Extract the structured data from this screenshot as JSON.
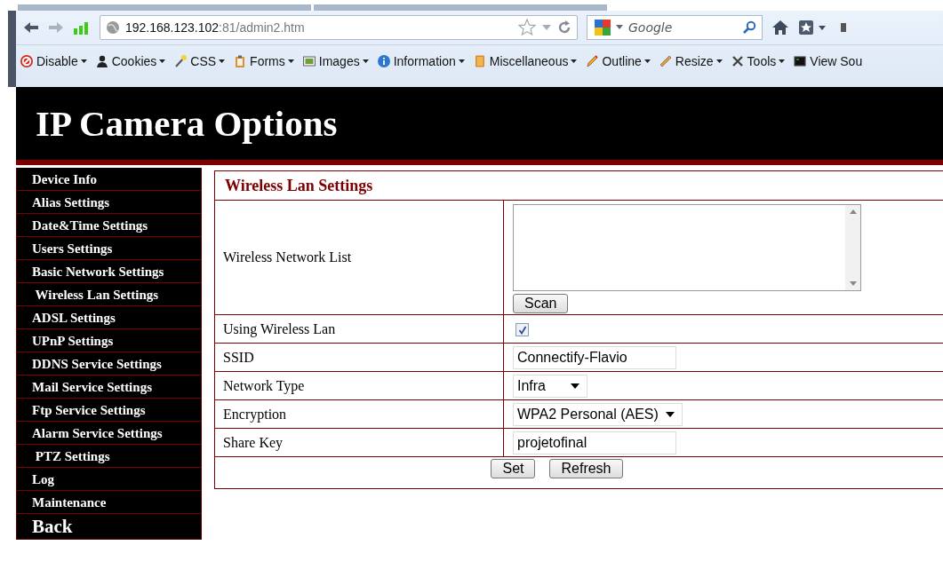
{
  "browser": {
    "address_host": "192.168.123.102",
    "address_rest": ":81/admin2.htm",
    "search_placeholder": "Google",
    "bookmarks": [
      {
        "label": "Disable"
      },
      {
        "label": "Cookies"
      },
      {
        "label": "CSS"
      },
      {
        "label": "Forms"
      },
      {
        "label": "Images"
      },
      {
        "label": "Information"
      },
      {
        "label": "Miscellaneous"
      },
      {
        "label": "Outline"
      },
      {
        "label": "Resize"
      },
      {
        "label": "Tools"
      },
      {
        "label": "View Sou"
      }
    ]
  },
  "page": {
    "title": "IP Camera Options",
    "sidebar": {
      "items": [
        {
          "label": "Device Info"
        },
        {
          "label": "Alias Settings"
        },
        {
          "label": "Date&Time Settings"
        },
        {
          "label": "Users Settings"
        },
        {
          "label": "Basic Network Settings"
        },
        {
          "label": " Wireless Lan Settings"
        },
        {
          "label": "ADSL Settings"
        },
        {
          "label": "UPnP Settings"
        },
        {
          "label": "DDNS Service Settings"
        },
        {
          "label": "Mail Service Settings"
        },
        {
          "label": "Ftp Service Settings"
        },
        {
          "label": "Alarm Service Settings"
        },
        {
          "label": " PTZ Settings"
        },
        {
          "label": "Log"
        },
        {
          "label": "Maintenance"
        },
        {
          "label": "Back",
          "kind": "large"
        }
      ]
    },
    "panel": {
      "title": "Wireless Lan Settings",
      "rows": [
        {
          "label": "Wireless Network List",
          "kind": "listbox",
          "button": "Scan"
        },
        {
          "label": "Using Wireless Lan",
          "kind": "checkbox",
          "checked": true
        },
        {
          "label": "SSID",
          "kind": "text",
          "value": "Connectify-Flavio"
        },
        {
          "label": "Network Type",
          "kind": "select",
          "value": "Infra"
        },
        {
          "label": "Encryption",
          "kind": "select",
          "value": "WPA2 Personal (AES)"
        },
        {
          "label": "Share Key",
          "kind": "text",
          "value": "projetofinal"
        }
      ],
      "buttons": [
        "Set",
        "Refresh"
      ]
    }
  }
}
